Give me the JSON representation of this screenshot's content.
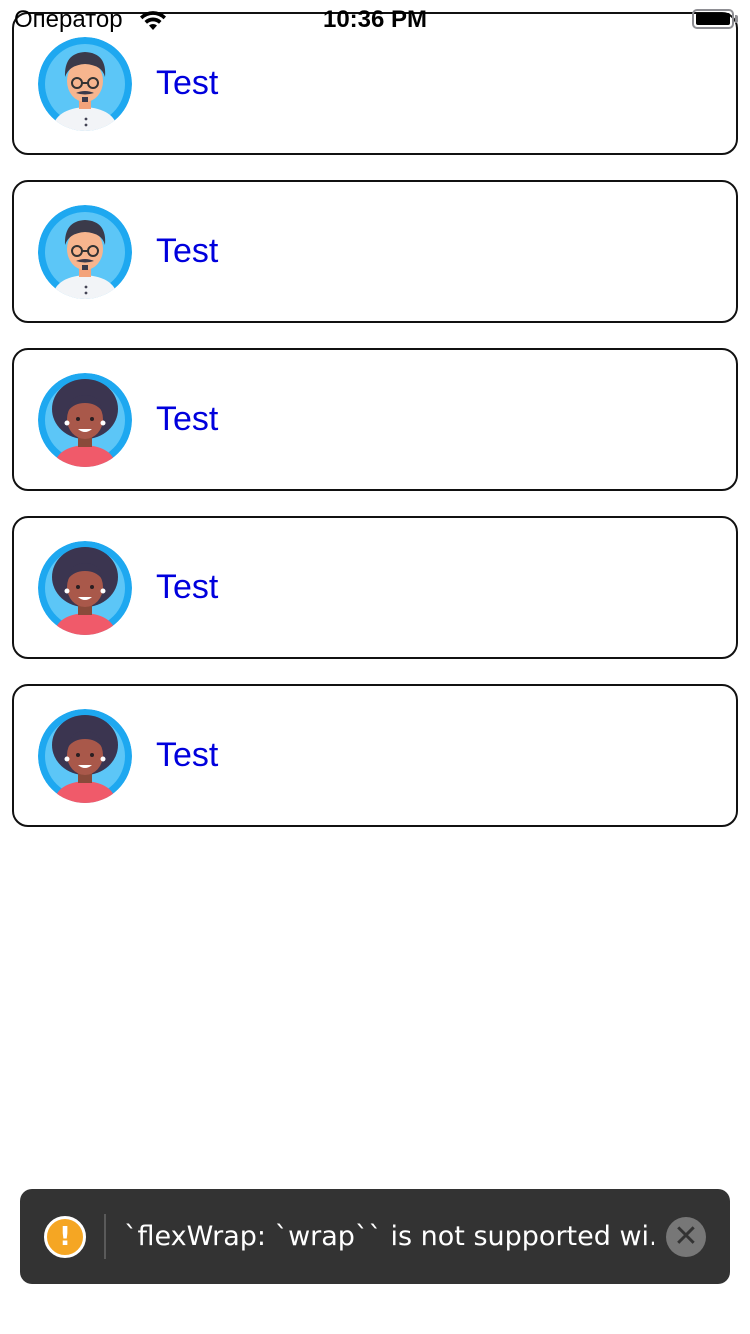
{
  "status_bar": {
    "carrier": "Оператор",
    "time": "10:36 PM",
    "wifi_icon": "wifi-icon",
    "battery_icon": "battery-icon"
  },
  "list": {
    "items": [
      {
        "label": "Test",
        "avatar": "man-glasses-avatar"
      },
      {
        "label": "Test",
        "avatar": "man-glasses-avatar"
      },
      {
        "label": "Test",
        "avatar": "woman-curly-avatar"
      },
      {
        "label": "Test",
        "avatar": "woman-curly-avatar"
      },
      {
        "label": "Test",
        "avatar": "woman-curly-avatar"
      }
    ]
  },
  "toast": {
    "icon": "warning-icon",
    "icon_glyph": "!",
    "message": "`flexWrap: `wrap`` is not supported wi...",
    "close_icon": "close-icon",
    "close_glyph": "✕"
  },
  "colors": {
    "label": "#0000dd",
    "card_border": "#111111",
    "toast_bg": "#333333",
    "warning": "#f5a623",
    "avatar_bg": "#1ea8f0"
  }
}
